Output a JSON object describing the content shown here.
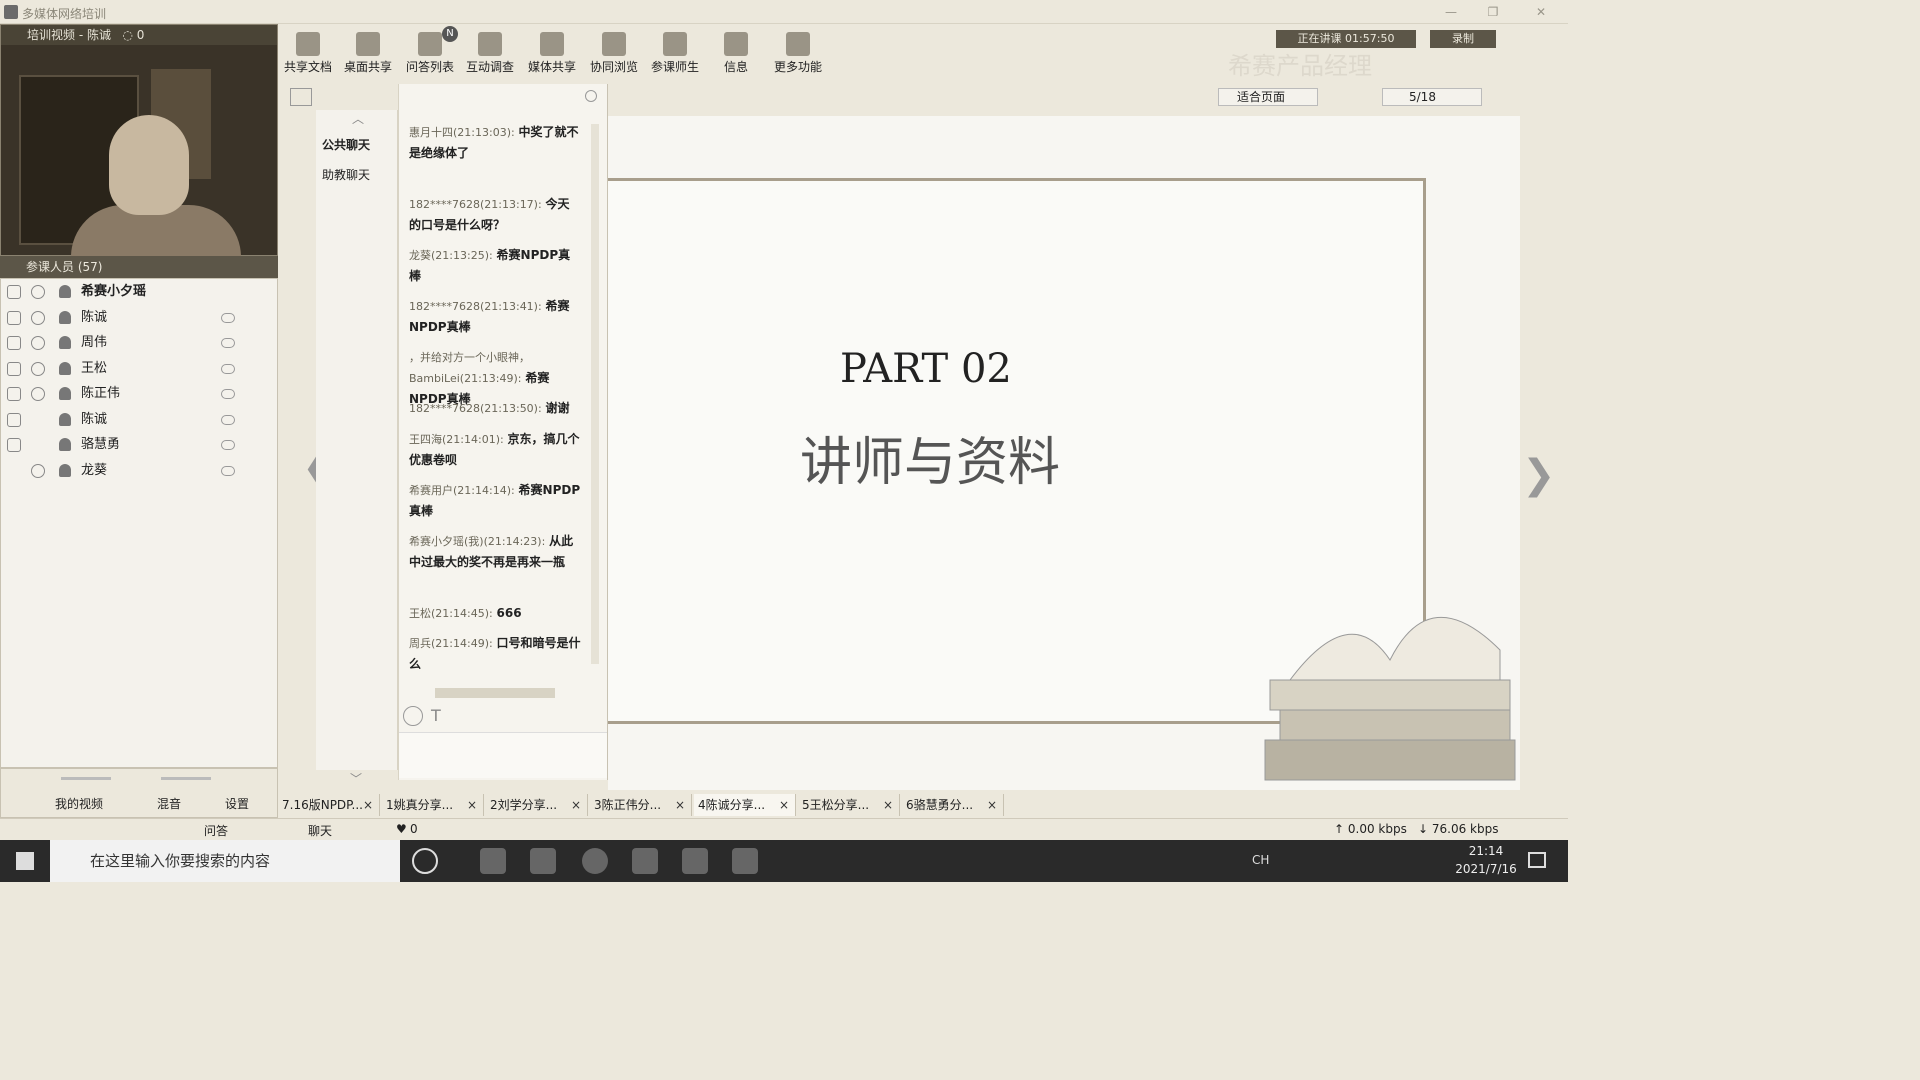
{
  "window": {
    "title": "多媒体网络培训"
  },
  "video": {
    "title": "培训视频 - 陈诚",
    "count": "0"
  },
  "participants": {
    "header": "参课人员 (57)",
    "items": [
      "希赛小夕瑶",
      "陈诚",
      "周伟",
      "王松",
      "陈正伟",
      "陈诚",
      "骆慧勇",
      "龙葵"
    ]
  },
  "toolbar": {
    "items": [
      "共享文档",
      "桌面共享",
      "问答列表",
      "互动调查",
      "媒体共享",
      "协同浏览",
      "参课师生",
      "信息",
      "更多功能"
    ],
    "badge": "N"
  },
  "top_right": {
    "status": "正在讲课 01:57:50",
    "record": "录制",
    "watermark": "希赛产品经理"
  },
  "chat_tabs": [
    "公共聊天",
    "助教聊天"
  ],
  "messages": [
    {
      "who": "惠月十四(21:13:03):",
      "text": "中奖了就不是绝缘体了"
    },
    {
      "who": "182****7628(21:13:17):",
      "text": "今天的口号是什么呀？"
    },
    {
      "who": "龙葵(21:13:25):",
      "text": "希赛NPDP真棒"
    },
    {
      "who": "182****7628(21:13:41):",
      "text": "希赛NPDP真棒"
    },
    {
      "who": "，并给对方一个小眼神，BambiLei(21:13:49):",
      "text": "希赛NPDP真棒"
    },
    {
      "who": "182****7628(21:13:50):",
      "text": "谢谢"
    },
    {
      "who": "王四海(21:14:01):",
      "text": "京东，搞几个优惠卷呗"
    },
    {
      "who": "希赛用户(21:14:14):",
      "text": "希赛NPDP真棒"
    },
    {
      "who": "希赛小夕瑶(我)(21:14:23):",
      "text": "从此中过最大的奖不再是再来一瓶"
    },
    {
      "who": "王松(21:14:45):",
      "text": "666"
    },
    {
      "who": "周兵(21:14:49):",
      "text": "口号和暗号是什么"
    }
  ],
  "slide_controls": {
    "fit": "适合页面",
    "page": "5/18"
  },
  "slide": {
    "part": "PART 02",
    "title": "讲师与资料"
  },
  "left_footer": {
    "my_video": "我的视频",
    "mix": "混音",
    "settings": "设置",
    "qa": "问答",
    "chat": "聊天",
    "likes": "0"
  },
  "doc_tabs": [
    "7.16版NPDP...",
    "1姚真分享...",
    "2刘学分享...",
    "3陈正伟分...",
    "4陈诚分享...",
    "5王松分享...",
    "6骆慧勇分..."
  ],
  "status": {
    "up": "0.00 kbps",
    "down": "76.06 kbps"
  },
  "taskbar": {
    "search": "在这里输入你要搜索的内容",
    "lang": "CH",
    "time": "21:14",
    "date": "2021/7/16"
  }
}
